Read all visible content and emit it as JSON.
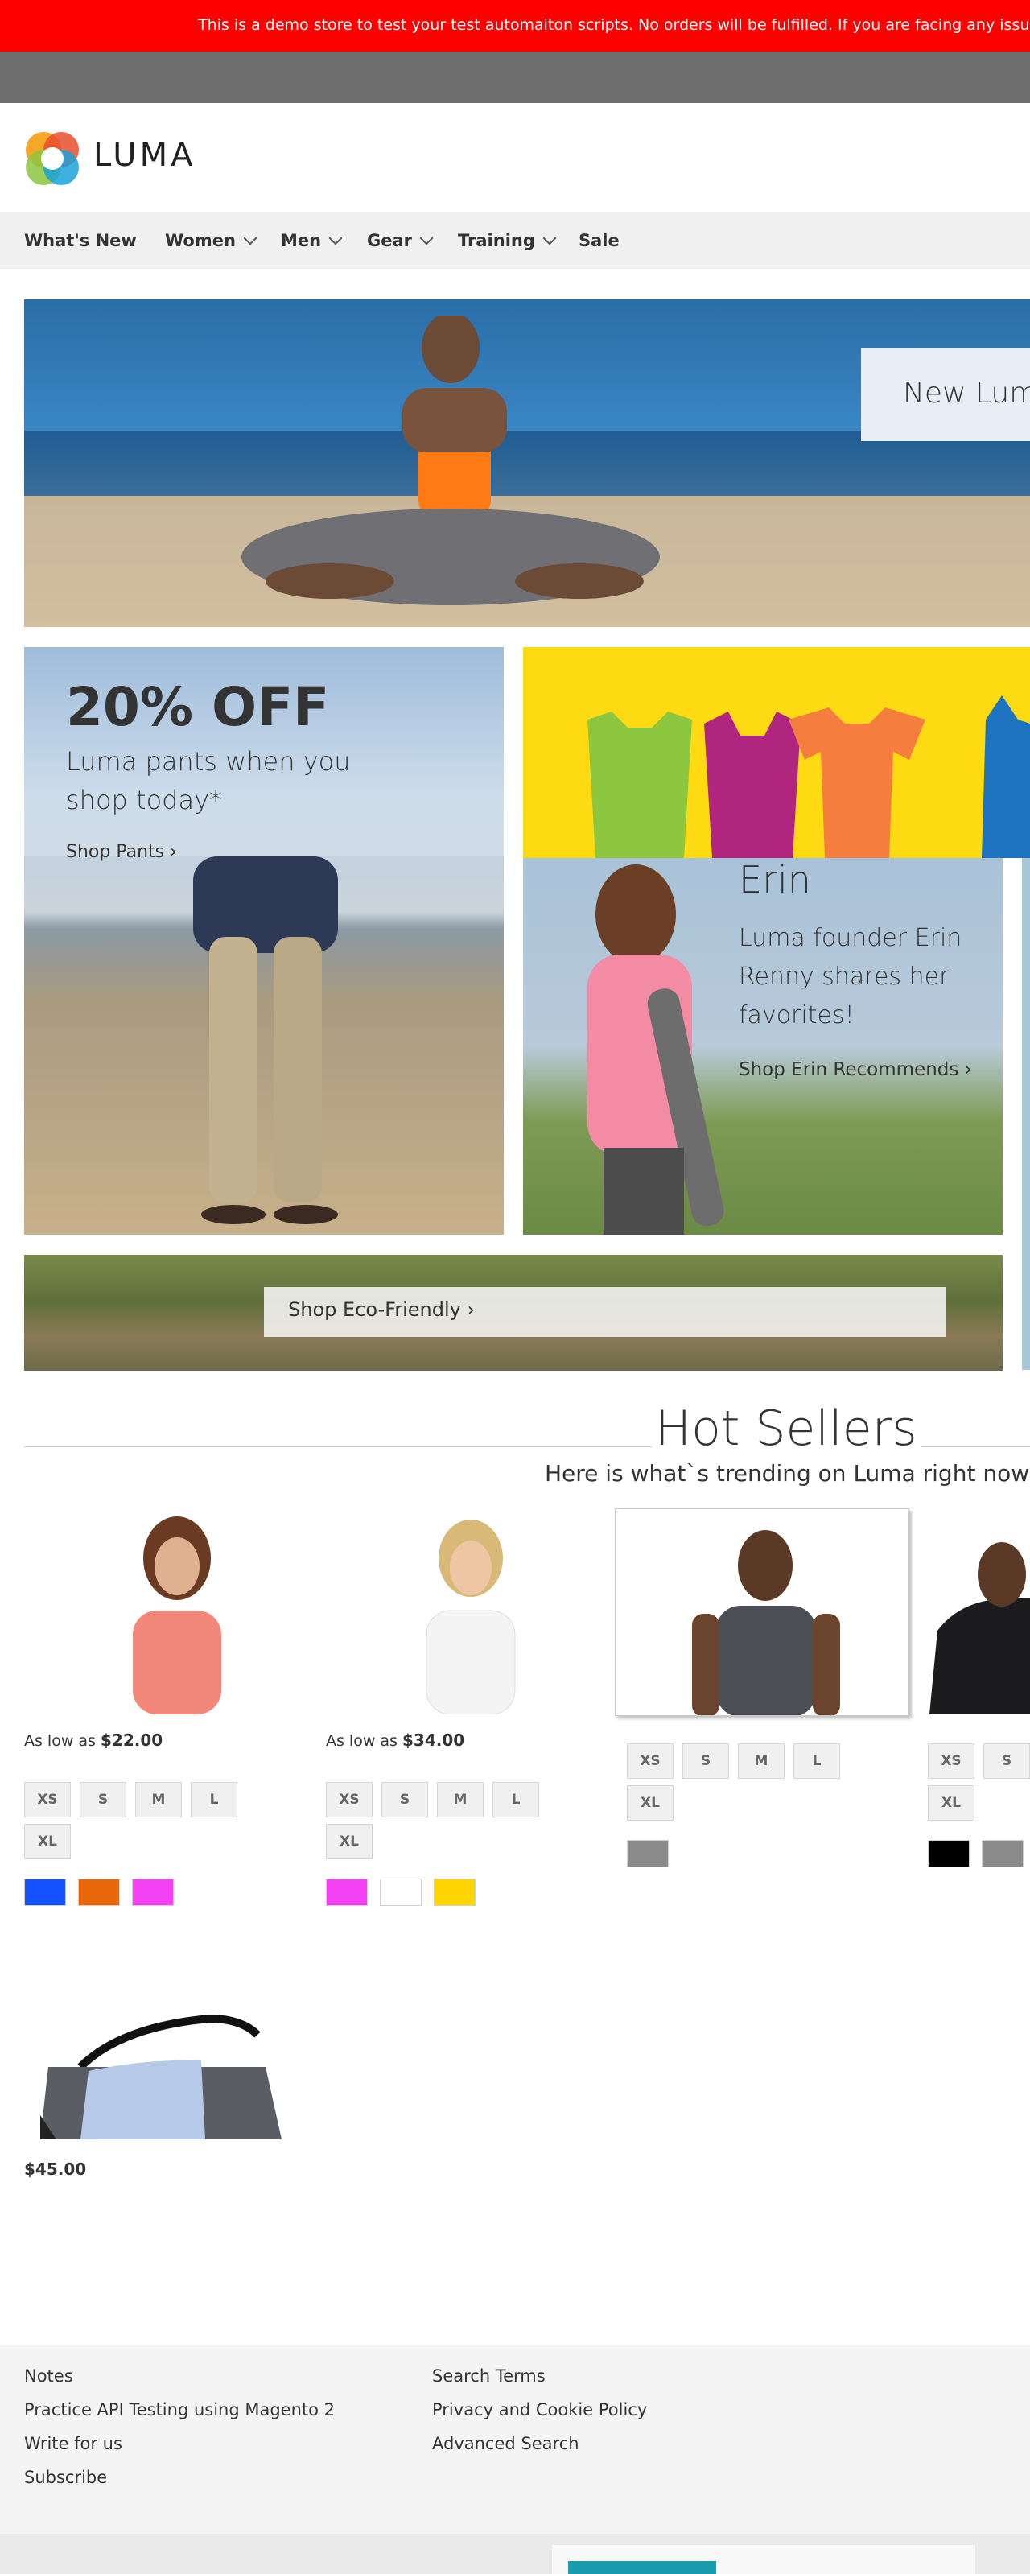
{
  "demo_notice": "This is a demo store to test your test automaiton scripts. No orders will be fulfilled. If you are facing any issue, ema",
  "brand": {
    "name": "LUMA"
  },
  "nav": {
    "items": [
      {
        "label": "What's New"
      },
      {
        "label": "Women"
      },
      {
        "label": "Men"
      },
      {
        "label": "Gear"
      },
      {
        "label": "Training"
      },
      {
        "label": "Sale"
      }
    ]
  },
  "hero": {
    "callout": "New Luma"
  },
  "promo_pants": {
    "title": "20% OFF",
    "subtitle": "Luma pants when you shop today*",
    "link": "Shop Pants"
  },
  "promo_erin": {
    "name": "Erin",
    "subtitle": "Luma founder Erin Renny shares her favorites!",
    "link": "Shop Erin Recommends"
  },
  "promo_eco": {
    "link": "Shop Eco-Friendly"
  },
  "hot_sellers": {
    "title": "Hot Sellers",
    "subtitle": "Here is what`s trending on Luma right now",
    "products": [
      {
        "price_prefix": "As low as",
        "price": "$22.00",
        "sizes": [
          "XS",
          "S",
          "M",
          "L",
          "XL"
        ],
        "colors": [
          "#1452ff",
          "#e8680a",
          "#f542f5"
        ]
      },
      {
        "price_prefix": "As low as",
        "price": "$34.00",
        "sizes": [
          "XS",
          "S",
          "M",
          "L",
          "XL"
        ],
        "colors": [
          "#f542f5",
          "#ffffff",
          "#ffd500"
        ]
      },
      {
        "sizes": [
          "XS",
          "S",
          "M",
          "L",
          "XL"
        ],
        "colors": [
          "#8c8c8c"
        ]
      },
      {
        "sizes": [
          "XS",
          "S",
          "XL"
        ],
        "colors": [
          "#000000",
          "#8c8c8c"
        ]
      },
      {
        "price": "$45.00"
      }
    ]
  },
  "footer": {
    "col1": [
      "Notes",
      "Practice API Testing using Magento 2",
      "Write for us",
      "Subscribe"
    ],
    "col2": [
      "Search Terms",
      "Privacy and Cookie Policy",
      "Advanced Search"
    ]
  }
}
